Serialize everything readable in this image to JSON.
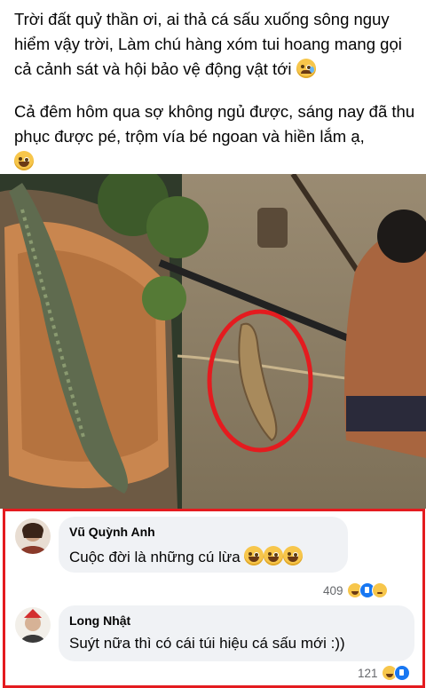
{
  "post": {
    "paragraph1": "Trời đất quỷ thần ơi, ai thả cá sấu xuống sông nguy hiểm vậy trời, Làm chú hàng xóm tui hoang mang gọi cả cảnh sát và hội bảo vệ động vật tới",
    "paragraph2": "Cả đêm hôm qua sợ không ngủ được, sáng nay đã thu phục được pé, trộm vía bé ngoan và hiền lắm ạ,",
    "emoji1": "crying-face-icon",
    "emoji2": "grinning-face-icon"
  },
  "comments": [
    {
      "name": "Vũ Quỳnh Anh",
      "text": "Cuộc đời là những cú lừa",
      "reaction_count": "409",
      "reactions": [
        "haha",
        "like",
        "sad"
      ]
    },
    {
      "name": "Long Nhật",
      "text": "Suýt nữa thì có cái túi hiệu cá sấu mới :))",
      "reaction_count": "121",
      "reactions": [
        "haha",
        "like"
      ]
    }
  ],
  "colors": {
    "highlight_border": "#e41b1f",
    "bubble_bg": "#f0f2f5",
    "like_blue": "#1877f2"
  }
}
